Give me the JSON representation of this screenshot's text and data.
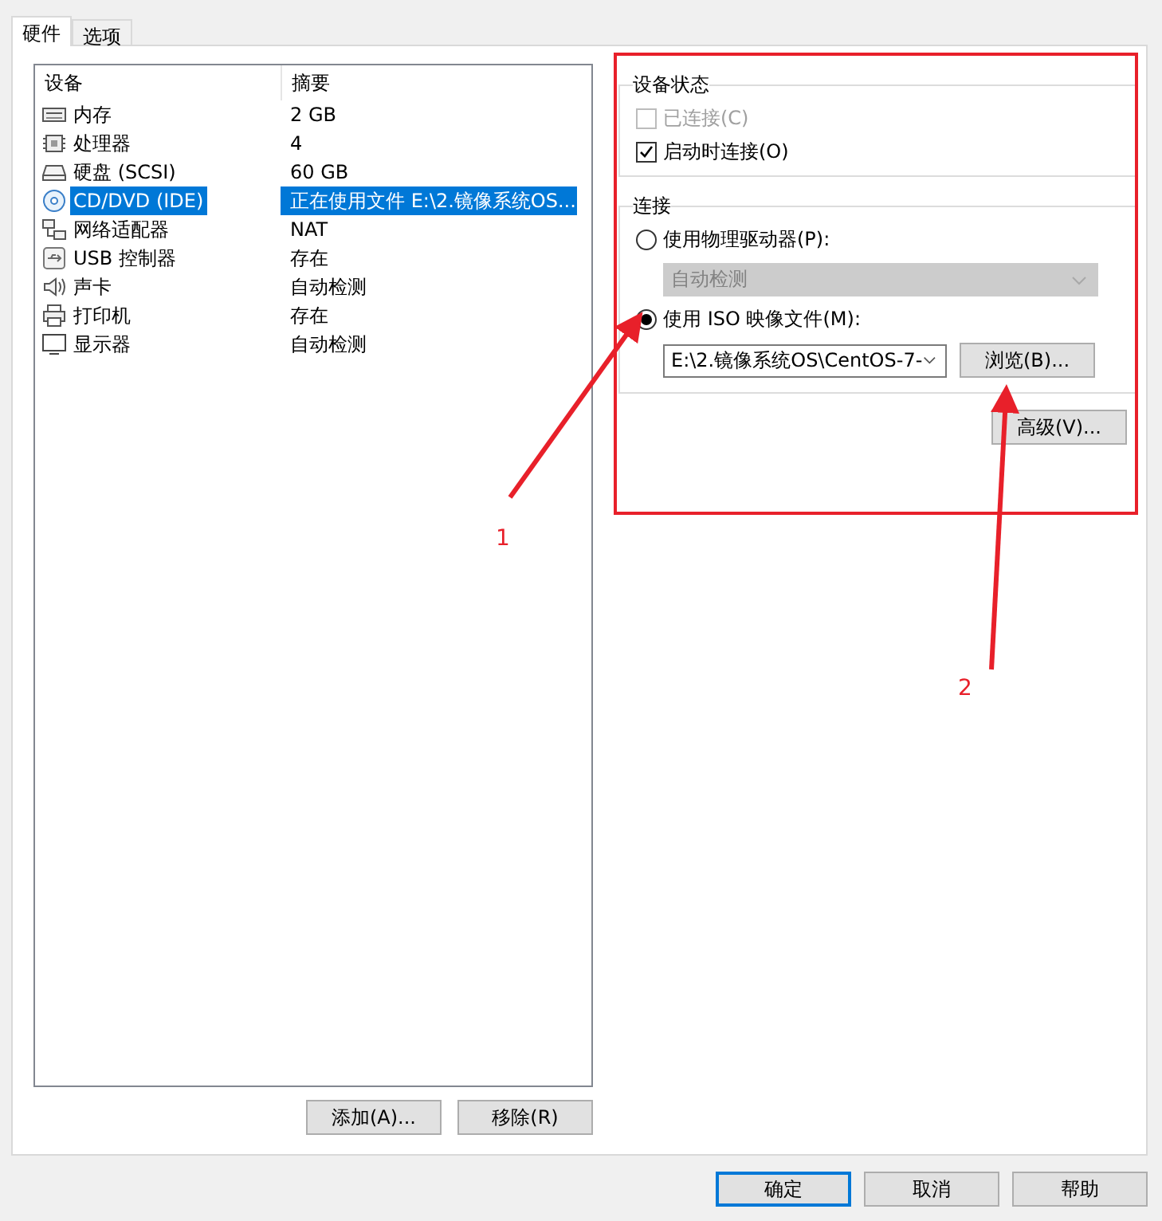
{
  "tabs": [
    {
      "label": "硬件",
      "selected": true
    },
    {
      "label": "选项",
      "selected": false
    }
  ],
  "devices": {
    "columns": [
      "设备",
      "摘要"
    ],
    "rows": [
      {
        "kind": "memory",
        "name": "内存",
        "summary": "2 GB",
        "selected": false
      },
      {
        "kind": "cpu",
        "name": "处理器",
        "summary": "4",
        "selected": false
      },
      {
        "kind": "disk",
        "name": "硬盘 (SCSI)",
        "summary": "60 GB",
        "selected": false
      },
      {
        "kind": "cd",
        "name": "CD/DVD (IDE)",
        "summary": "正在使用文件 E:\\2.镜像系统OS...",
        "selected": true
      },
      {
        "kind": "network",
        "name": "网络适配器",
        "summary": "NAT",
        "selected": false
      },
      {
        "kind": "usb",
        "name": "USB 控制器",
        "summary": "存在",
        "selected": false
      },
      {
        "kind": "sound",
        "name": "声卡",
        "summary": "自动检测",
        "selected": false
      },
      {
        "kind": "printer",
        "name": "打印机",
        "summary": "存在",
        "selected": false
      },
      {
        "kind": "display",
        "name": "显示器",
        "summary": "自动检测",
        "selected": false
      }
    ]
  },
  "list_buttons": [
    "添加(A)...",
    "移除(R)"
  ],
  "device_status": {
    "title": "设备状态",
    "options": [
      {
        "label": "已连接(C)",
        "checked": false,
        "disabled": true
      },
      {
        "label": "启动时连接(O)",
        "checked": true,
        "disabled": false
      }
    ]
  },
  "connection": {
    "title": "连接",
    "physical": {
      "label": "使用物理驱动器(P):",
      "selected": false,
      "dropdown": {
        "value": "自动检测",
        "disabled": true
      }
    },
    "iso": {
      "label": "使用 ISO 映像文件(M):",
      "selected": true,
      "dropdown": {
        "value": "E:\\2.镜像系统OS\\CentOS-7-",
        "disabled": false
      },
      "browse": "浏览(B)..."
    }
  },
  "advanced_button": "高级(V)...",
  "dialog_buttons": [
    {
      "label": "确定",
      "default": true
    },
    {
      "label": "取消",
      "default": false
    },
    {
      "label": "帮助",
      "default": false
    }
  ],
  "annotations": [
    {
      "label": "1"
    },
    {
      "label": "2"
    }
  ]
}
